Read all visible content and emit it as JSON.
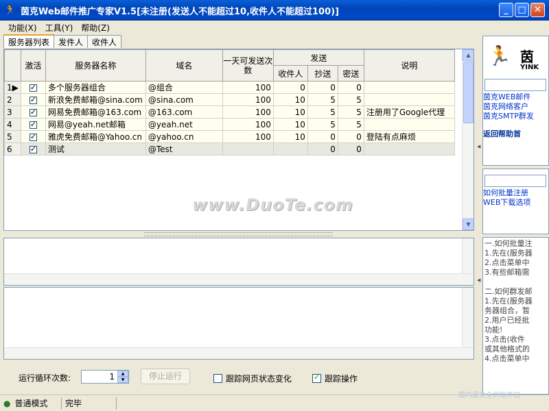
{
  "window": {
    "title": "茵克Web邮件推广专家V1.5[未注册(发送人不能超过10,收件人不能超过100)]",
    "minimize": "_",
    "maximize": "□",
    "close": "✕"
  },
  "menu": [
    {
      "label": "功能(X)"
    },
    {
      "label": "工具(Y)"
    },
    {
      "label": "帮助(Z)"
    }
  ],
  "tabs": [
    {
      "label": "服务器列表"
    },
    {
      "label": "发件人"
    },
    {
      "label": "收件人"
    }
  ],
  "grid": {
    "headers": {
      "active": "激活",
      "server_name": "服务器名称",
      "domain": "域名",
      "daily_max": "一天可发送次数",
      "send_group": "发送",
      "to": "收件人",
      "cc": "抄送",
      "bcc": "密送",
      "note": "说明"
    },
    "rows": [
      {
        "idx": "1",
        "name": "多个服务器组合",
        "domain": "@组合",
        "daily": "100",
        "to": "0",
        "cc": "0",
        "bcc": "0",
        "note": ""
      },
      {
        "idx": "2",
        "name": "新浪免费邮箱@sina.com",
        "domain": "@sina.com",
        "daily": "100",
        "to": "10",
        "cc": "5",
        "bcc": "5",
        "note": ""
      },
      {
        "idx": "3",
        "name": "网易免费邮箱@163.com",
        "domain": "@163.com",
        "daily": "100",
        "to": "10",
        "cc": "5",
        "bcc": "5",
        "note": "注册用了Google代理"
      },
      {
        "idx": "4",
        "name": "网易@yeah.net邮箱",
        "domain": "@yeah.net",
        "daily": "100",
        "to": "10",
        "cc": "5",
        "bcc": "5",
        "note": ""
      },
      {
        "idx": "5",
        "name": "雅虎免费邮箱@Yahoo.cn",
        "domain": "@yahoo.cn",
        "daily": "100",
        "to": "10",
        "cc": "0",
        "bcc": "0",
        "note": "登陆有点麻烦"
      },
      {
        "idx": "6",
        "name": "测试",
        "domain": "@Test",
        "daily": "",
        "to": "",
        "cc": "0",
        "bcc": "0",
        "note": ""
      }
    ]
  },
  "watermark": "www.DuoTe.com",
  "bottom": {
    "loop_label": "运行循环次数:",
    "loop_value": "1",
    "stop_button": "停止运行",
    "track_page": "跟踪网页状态变化",
    "track_action": "跟踪操作"
  },
  "status": {
    "mode": "普通模式",
    "state": "完毕"
  },
  "right_panel": {
    "logo_text": "茵",
    "logo_sub": "YINK",
    "links1": [
      "茵克WEB邮件",
      "茵克网络客户",
      "茵克SMTP群发"
    ],
    "home_link": "返回帮助首",
    "links2": [
      "如何批量注册",
      "WEB下载选项"
    ],
    "help_lines": [
      "一.如何批量注",
      "1.先在(服务器",
      "2.点击菜单中",
      "3.有些邮箱需",
      "",
      "二.如何群发邮",
      "1.先在(服务器",
      "务器组合，暂",
      "2.用户已经批",
      "功能!",
      "3.点击(收件",
      "或其他格式的",
      "4.点击菜单中"
    ]
  },
  "corner_watermark": "国内最安全的软件站",
  "colors": {
    "title_bar": "#0a5fd8",
    "window_bg": "#ece9d8",
    "row_bg": "#fffff0",
    "link": "#0033cc"
  }
}
